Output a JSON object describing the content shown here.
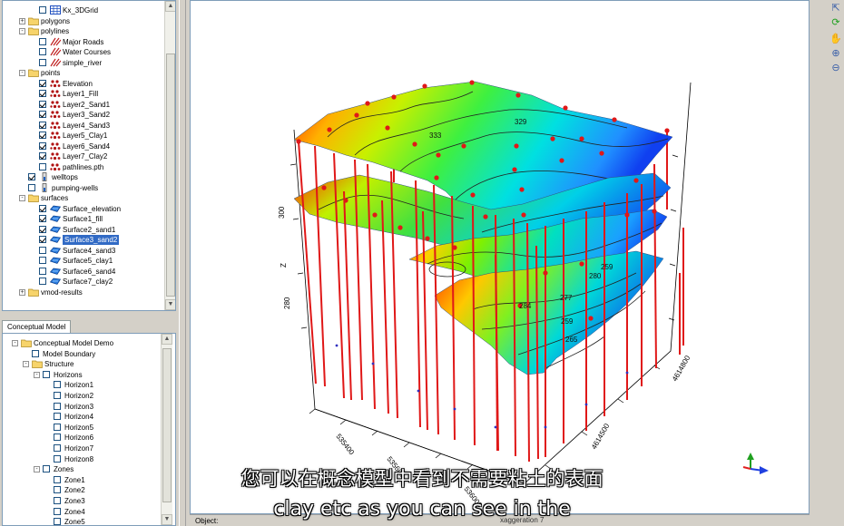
{
  "data_tree": {
    "items": [
      {
        "label": "Kx_3DGrid",
        "indent": 1,
        "checked": false,
        "icon": "grid"
      },
      {
        "label": "polygons",
        "indent": 0,
        "icon": "folder",
        "expander": "+"
      },
      {
        "label": "polylines",
        "indent": 0,
        "icon": "folder",
        "expander": "-"
      },
      {
        "label": "Major Roads",
        "indent": 1,
        "checked": false,
        "icon": "lines"
      },
      {
        "label": "Water Courses",
        "indent": 1,
        "checked": false,
        "icon": "lines"
      },
      {
        "label": "simple_river",
        "indent": 1,
        "checked": false,
        "icon": "lines"
      },
      {
        "label": "points",
        "indent": 0,
        "icon": "folder",
        "expander": "-"
      },
      {
        "label": "Elevation",
        "indent": 1,
        "checked": true,
        "icon": "points"
      },
      {
        "label": "Layer1_Fill",
        "indent": 1,
        "checked": true,
        "icon": "points"
      },
      {
        "label": "Layer2_Sand1",
        "indent": 1,
        "checked": true,
        "icon": "points"
      },
      {
        "label": "Layer3_Sand2",
        "indent": 1,
        "checked": true,
        "icon": "points"
      },
      {
        "label": "Layer4_Sand3",
        "indent": 1,
        "checked": true,
        "icon": "points"
      },
      {
        "label": "Layer5_Clay1",
        "indent": 1,
        "checked": true,
        "icon": "points"
      },
      {
        "label": "Layer6_Sand4",
        "indent": 1,
        "checked": true,
        "icon": "points"
      },
      {
        "label": "Layer7_Clay2",
        "indent": 1,
        "checked": true,
        "icon": "points"
      },
      {
        "label": "pathlines.pth",
        "indent": 1,
        "checked": false,
        "icon": "points"
      },
      {
        "label": "welltops",
        "indent": 0,
        "checked": true,
        "icon": "well"
      },
      {
        "label": "pumping-wells",
        "indent": 0,
        "checked": false,
        "icon": "well"
      },
      {
        "label": "surfaces",
        "indent": 0,
        "icon": "folder",
        "expander": "-"
      },
      {
        "label": "Surface_elevation",
        "indent": 1,
        "checked": true,
        "icon": "surface"
      },
      {
        "label": "Surface1_fill",
        "indent": 1,
        "checked": true,
        "icon": "surface"
      },
      {
        "label": "Surface2_sand1",
        "indent": 1,
        "checked": true,
        "icon": "surface"
      },
      {
        "label": "Surface3_sand2",
        "indent": 1,
        "checked": true,
        "icon": "surface",
        "selected": true
      },
      {
        "label": "Surface4_sand3",
        "indent": 1,
        "checked": false,
        "icon": "surface"
      },
      {
        "label": "Surface5_clay1",
        "indent": 1,
        "checked": false,
        "icon": "surface"
      },
      {
        "label": "Surface6_sand4",
        "indent": 1,
        "checked": false,
        "icon": "surface"
      },
      {
        "label": "Surface7_clay2",
        "indent": 1,
        "checked": false,
        "icon": "surface"
      },
      {
        "label": "vmod-results",
        "indent": 0,
        "icon": "folder",
        "expander": "+"
      }
    ]
  },
  "conceptual_tab": {
    "label": "Conceptual Model"
  },
  "model_tree": {
    "items": [
      {
        "label": "Conceptual Model Demo",
        "indent": 0,
        "expander": "-",
        "icon": "folder"
      },
      {
        "label": "Model Boundary",
        "indent": 1,
        "checkbox": true
      },
      {
        "label": "Structure",
        "indent": 1,
        "expander": "-",
        "icon": "folder"
      },
      {
        "label": "Horizons",
        "indent": 2,
        "expander": "-",
        "checkbox": true
      },
      {
        "label": "Horizon1",
        "indent": 3,
        "checkbox": true
      },
      {
        "label": "Horizon2",
        "indent": 3,
        "checkbox": true
      },
      {
        "label": "Horizon3",
        "indent": 3,
        "checkbox": true
      },
      {
        "label": "Horizon4",
        "indent": 3,
        "checkbox": true
      },
      {
        "label": "Horizon5",
        "indent": 3,
        "checkbox": true
      },
      {
        "label": "Horizon6",
        "indent": 3,
        "checkbox": true
      },
      {
        "label": "Horizon7",
        "indent": 3,
        "checkbox": true
      },
      {
        "label": "Horizon8",
        "indent": 3,
        "checkbox": true
      },
      {
        "label": "Zones",
        "indent": 2,
        "expander": "-",
        "checkbox": true
      },
      {
        "label": "Zone1",
        "indent": 3,
        "checkbox": true
      },
      {
        "label": "Zone2",
        "indent": 3,
        "checkbox": true
      },
      {
        "label": "Zone3",
        "indent": 3,
        "checkbox": true
      },
      {
        "label": "Zone4",
        "indent": 3,
        "checkbox": true
      },
      {
        "label": "Zone5",
        "indent": 3,
        "checkbox": true
      }
    ]
  },
  "viewer": {
    "z_axis_title": "Z",
    "z_ticks": [
      "300",
      "280"
    ],
    "x_ticks": [
      "535400",
      "535600",
      "536000"
    ],
    "y_ticks": [
      "4614500",
      "4614800"
    ],
    "contours": [
      "333",
      "329",
      "284",
      "280",
      "277",
      "259",
      "265",
      "259"
    ],
    "x_partial": "xaggeration",
    "x_partial_num": "7"
  },
  "status_bar": {
    "object_label": "Object:"
  },
  "toolbar": {
    "icons": [
      "pointer-icon",
      "rotate-icon",
      "pan-icon",
      "zoom-in-icon",
      "zoom-out-icon"
    ]
  },
  "subtitles": {
    "chinese": "您可以在概念模型中看到不需要粘土的表面",
    "english": "clay etc as you can see in the"
  }
}
